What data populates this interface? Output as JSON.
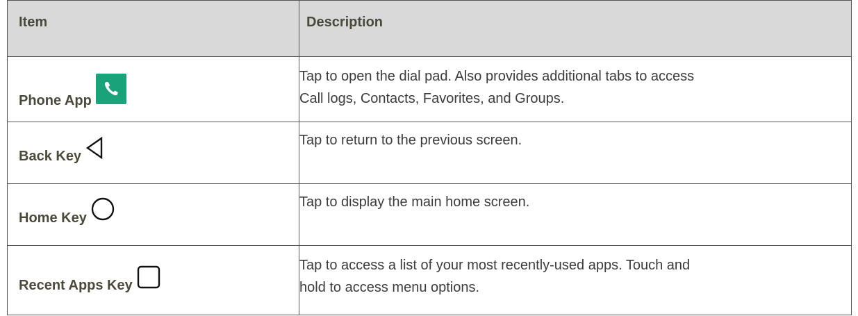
{
  "table": {
    "headers": {
      "item": "Item",
      "description": "Description"
    },
    "rows": [
      {
        "item": "Phone App",
        "icon": "phone-app-icon",
        "description_lines": [
          "Tap to open the dial pad. Also provides additional tabs to access",
          "Call logs, Contacts, Favorites, and Groups."
        ]
      },
      {
        "item": "Back Key",
        "icon": "back-triangle-icon",
        "description_lines": [
          "Tap to return to the previous screen."
        ]
      },
      {
        "item": "Home Key",
        "icon": "home-circle-icon",
        "description_lines": [
          "Tap to display the main home screen."
        ]
      },
      {
        "item": "Recent Apps Key",
        "icon": "recent-apps-square-icon",
        "description_lines": [
          "Tap to access a list of your most recently-used apps. Touch and",
          "hold to access menu options."
        ]
      }
    ]
  },
  "colors": {
    "header_bg": "#d9d9d9",
    "border": "#555555",
    "label_text": "#4a4a3c",
    "body_text": "#3c3c3c",
    "phone_icon_bg": "#1aa37a"
  }
}
